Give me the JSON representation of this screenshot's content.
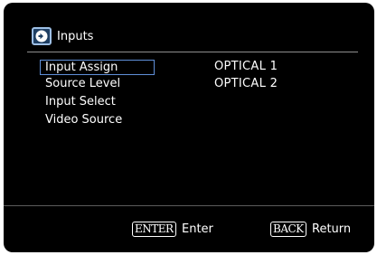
{
  "header": {
    "title": "Inputs",
    "icon": "input-arrow-icon"
  },
  "menu": {
    "items": [
      {
        "label": "Input Assign",
        "selected": true
      },
      {
        "label": "Source Level",
        "selected": false
      },
      {
        "label": "Input Select",
        "selected": false
      },
      {
        "label": "Video Source",
        "selected": false
      }
    ]
  },
  "values": [
    "OPTICAL 1",
    "OPTICAL 2"
  ],
  "footer": {
    "enter_key": "ENTER",
    "enter_label": "Enter",
    "back_key": "BACK",
    "back_label": "Return"
  },
  "colors": {
    "background": "#000000",
    "text": "#ffffff",
    "selection_border": "#5f8fd8",
    "icon_border": "#9ec0e6"
  }
}
